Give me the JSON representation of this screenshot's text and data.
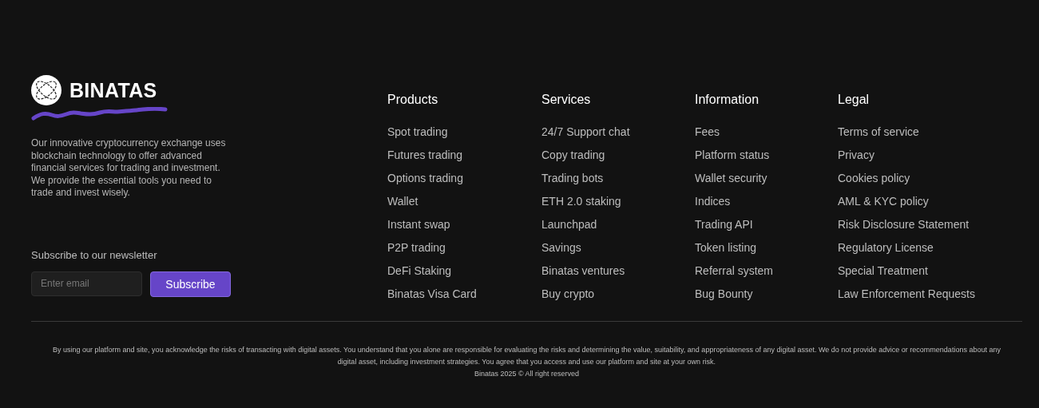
{
  "brand": {
    "name": "BINATAS",
    "description": "Our innovative cryptocurrency exchange uses blockchain technology to offer advanced financial services for trading and investment. We provide the essential tools you need to trade and invest wisely."
  },
  "newsletter": {
    "title": "Subscribe to our newsletter",
    "placeholder": "Enter email",
    "button": "Subscribe"
  },
  "columns": [
    {
      "title": "Products",
      "links": [
        "Spot trading",
        "Futures trading",
        "Options trading",
        "Wallet",
        "Instant swap",
        "P2P trading",
        "DeFi Staking",
        "Binatas Visa Card"
      ]
    },
    {
      "title": "Services",
      "links": [
        "24/7 Support chat",
        "Copy trading",
        "Trading bots",
        "ETH 2.0 staking",
        "Launchpad",
        "Savings",
        "Binatas ventures",
        "Buy crypto"
      ]
    },
    {
      "title": "Information",
      "links": [
        "Fees",
        "Platform status",
        "Wallet security",
        "Indices",
        "Trading API",
        "Token listing",
        "Referral system",
        "Bug Bounty"
      ]
    },
    {
      "title": "Legal",
      "links": [
        "Terms of service",
        "Privacy",
        "Cookies policy",
        "AML & KYC policy",
        "Risk Disclosure Statement",
        "Regulatory License",
        "Special Treatment",
        "Law Enforcement Requests"
      ]
    }
  ],
  "disclaimer": "By using our platform and site, you acknowledge the risks of transacting with digital assets. You understand that you alone are responsible for evaluating the risks and determining the value, suitability, and appropriateness of any digital asset. We do not provide advice or recommendations about any digital asset, including investment strategies. You agree that you access and use our platform and site at your own risk.",
  "copyright": "Binatas 2025 © All right reserved"
}
